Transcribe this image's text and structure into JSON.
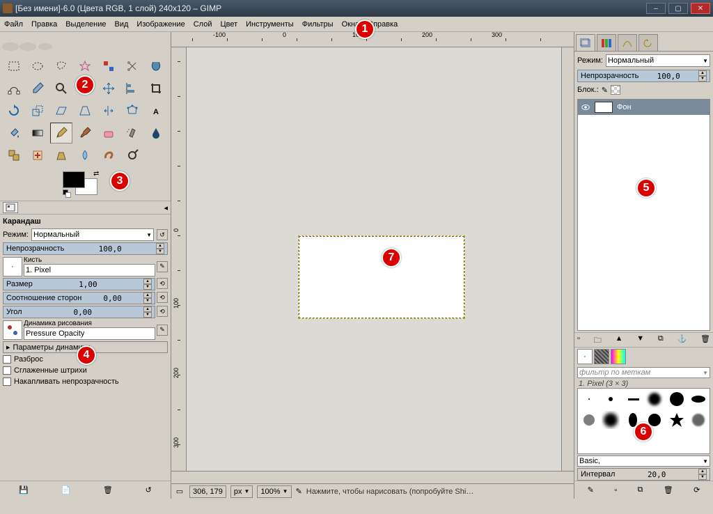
{
  "window": {
    "title": "[Без имени]-6.0 (Цвета RGB, 1 слой) 240x120 – GIMP"
  },
  "menu": [
    "Файл",
    "Правка",
    "Выделение",
    "Вид",
    "Изображение",
    "Слой",
    "Цвет",
    "Инструменты",
    "Фильтры",
    "Окна",
    "Справка"
  ],
  "toolbox": {
    "tools": [
      "rect-select",
      "ellipse-select",
      "free-select",
      "fuzzy-select",
      "by-color-select",
      "scissors",
      "foreground-select",
      "paths",
      "color-picker",
      "zoom",
      "measure",
      "move",
      "align",
      "crop",
      "rotate",
      "scale",
      "shear",
      "perspective",
      "flip",
      "cage",
      "text",
      "bucket",
      "blend",
      "pencil",
      "paintbrush",
      "eraser",
      "airbrush",
      "ink",
      "clone",
      "heal",
      "perspective-clone",
      "blur",
      "smudge",
      "dodge"
    ],
    "active": "pencil"
  },
  "tool_options": {
    "title": "Карандаш",
    "mode_label": "Режим:",
    "mode_value": "Нормальный",
    "opacity_label": "Непрозрачность",
    "opacity_value": "100,0",
    "brush_label": "Кисть",
    "brush_name": "1. Pixel",
    "size_label": "Размер",
    "size_value": "1,00",
    "aspect_label": "Соотношение сторон",
    "aspect_value": "0,00",
    "angle_label": "Угол",
    "angle_value": "0,00",
    "dynamics_label": "Динамика рисования",
    "dynamics_value": "Pressure Opacity",
    "dyn_params": "Параметры динамики",
    "scatter": "Разброс",
    "smooth": "Сглаженные штрихи",
    "accumulate": "Накапливать непрозрачность"
  },
  "canvas": {
    "coords": "306, 179",
    "unit": "px",
    "zoom": "100%",
    "hint": "Нажмите, чтобы нарисовать (попробуйте Shi…",
    "ruler_marks": [
      "-100",
      "0",
      "100",
      "200",
      "300"
    ],
    "vruler_marks": [
      "0",
      "100",
      "200",
      "300"
    ]
  },
  "layers": {
    "mode_label": "Режим:",
    "mode_value": "Нормальный",
    "opacity_label": "Непрозрачность",
    "opacity_value": "100,0",
    "lock_label": "Блок.:",
    "layer_name": "Фон"
  },
  "brushes": {
    "tags_placeholder": "фильтр по меткам",
    "current": "1. Pixel (3 × 3)",
    "category": "Basic,",
    "spacing_label": "Интервал",
    "spacing_value": "20,0"
  },
  "badges": [
    "1",
    "2",
    "3",
    "4",
    "5",
    "6",
    "7"
  ]
}
